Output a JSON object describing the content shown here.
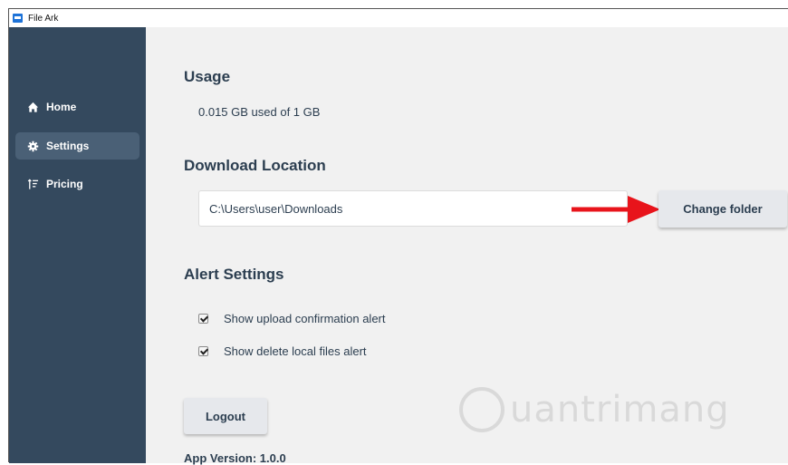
{
  "window": {
    "title": "File Ark"
  },
  "sidebar": {
    "items": [
      {
        "label": "Home",
        "icon": "home-icon",
        "active": false
      },
      {
        "label": "Settings",
        "icon": "gear-icon",
        "active": true
      },
      {
        "label": "Pricing",
        "icon": "sort-icon",
        "active": false
      }
    ]
  },
  "usage": {
    "title": "Usage",
    "text": "0.015 GB used of 1 GB"
  },
  "download": {
    "title": "Download Location",
    "path": "C:\\Users\\user\\Downloads",
    "button": "Change folder"
  },
  "alerts": {
    "title": "Alert Settings",
    "options": [
      {
        "label": "Show upload confirmation alert",
        "checked": true
      },
      {
        "label": "Show delete local files alert",
        "checked": true
      }
    ]
  },
  "logout": {
    "label": "Logout"
  },
  "version": {
    "text": "App Version: 1.0.0"
  },
  "colors": {
    "sidebar": "#34495e",
    "active": "#4a6076",
    "content": "#f1f1f1",
    "text": "#2c3e50",
    "arrow": "#e8141b"
  },
  "watermark": {
    "text": "uantrimang"
  }
}
